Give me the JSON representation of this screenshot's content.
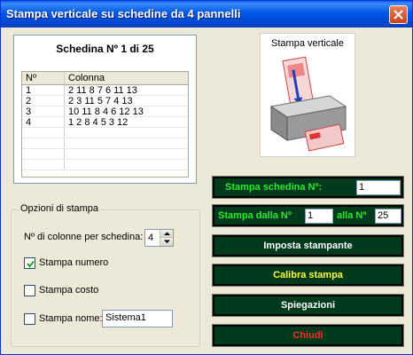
{
  "window": {
    "title": "Stampa verticale su schedine da 4 pannelli"
  },
  "grid": {
    "title": "Schedina Nº 1 di 25",
    "headers": {
      "n": "Nº",
      "colonna": "Colonna"
    },
    "rows": [
      {
        "n": "1",
        "colonna": "2 11 8 7 6 11 13"
      },
      {
        "n": "2",
        "colonna": "2 3 11 5 7 4 13"
      },
      {
        "n": "3",
        "colonna": "10 11 8 4 6 12 13"
      },
      {
        "n": "4",
        "colonna": "1 2 8 4 5 3 12"
      }
    ]
  },
  "options": {
    "group_label": "Opzioni di stampa",
    "columns_label": "Nº di colonne per schedina:",
    "columns_value": "4",
    "stampa_numero": {
      "label": "Stampa numero",
      "checked": true
    },
    "stampa_costo": {
      "label": "Stampa costo",
      "checked": false
    },
    "stampa_nome": {
      "label": "Stampa nome:",
      "checked": false,
      "value": "Sistema1"
    }
  },
  "printer": {
    "caption": "Stampa verticale"
  },
  "buttons": {
    "stampa_schedina": {
      "label": "Stampa schedina Nº:",
      "value": "1"
    },
    "stampa_dalla": {
      "label": "Stampa dalla Nº",
      "from": "1",
      "to_label": "alla Nº",
      "to": "25"
    },
    "imposta": "Imposta stampante",
    "calibra": "Calibra stampa",
    "spiegazioni": "Spiegazioni",
    "chiudi": "Chiudi"
  },
  "colors": {
    "button_bg": "#003a1c",
    "green": "#2eea2e",
    "yellow": "#ffff30",
    "red": "#ff2a2a"
  }
}
